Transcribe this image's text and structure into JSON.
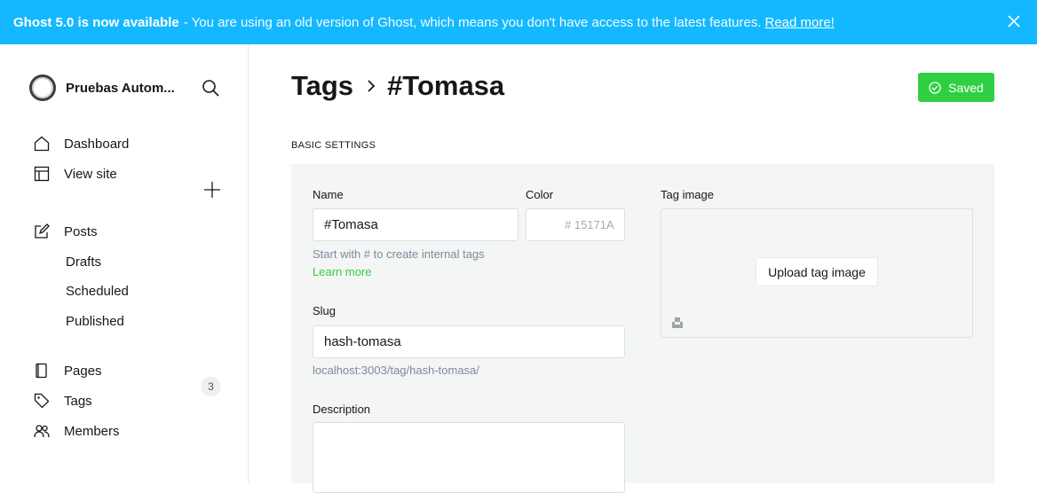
{
  "banner": {
    "headline": "Ghost 5.0 is now available",
    "message": " - You are using an old version of Ghost, which means you don't have access to the latest features.",
    "link": "Read more!"
  },
  "sidebar": {
    "site_name": "Pruebas Autom...",
    "nav": [
      {
        "label": "Dashboard"
      },
      {
        "label": "View site"
      },
      {
        "label": "Posts"
      },
      {
        "label": "Drafts"
      },
      {
        "label": "Scheduled"
      },
      {
        "label": "Published"
      },
      {
        "label": "Pages"
      },
      {
        "label": "Tags"
      },
      {
        "label": "Members"
      }
    ],
    "members_count": "3"
  },
  "header": {
    "breadcrumb_parent": "Tags",
    "breadcrumb_current": "#Tomasa",
    "saved_label": "Saved"
  },
  "form": {
    "section": "BASIC SETTINGS",
    "name_label": "Name",
    "name_value": "#Tomasa",
    "name_hint": "Start with # to create internal tags",
    "learn_more": "Learn more",
    "color_label": "Color",
    "color_value": "# 15171A",
    "slug_label": "Slug",
    "slug_value": "hash-tomasa",
    "slug_url": "localhost:3003/tag/hash-tomasa/",
    "description_label": "Description",
    "tag_image_label": "Tag image",
    "upload_label": "Upload tag image"
  },
  "colors": {
    "banner": "#14b8ff",
    "accent": "#30cf43"
  }
}
